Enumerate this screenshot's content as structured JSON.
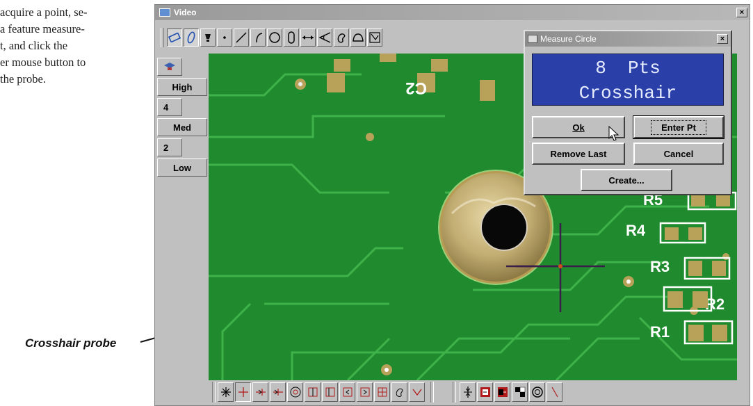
{
  "document": {
    "lines": [
      "acquire a point, se-",
      "a feature measure-",
      "t,  and  click  the",
      "er mouse button to",
      "the probe."
    ],
    "caption": "Crosshair probe"
  },
  "video_window": {
    "title": "Video",
    "close_label": "×",
    "toolbar_icons": [
      "rectangle-tool-icon",
      "ellipse-tool-icon",
      "light-icon",
      "point-icon",
      "line-icon",
      "arc-icon",
      "circle-icon",
      "slot-icon",
      "distance-icon",
      "angle-icon",
      "blob-icon",
      "curve-icon",
      "profile-icon",
      "view-icon"
    ],
    "side_buttons": {
      "top_icon": "cap-icon",
      "high": "High",
      "four": "4",
      "med": "Med",
      "two": "2",
      "low": "Low"
    },
    "bottom_icons": [
      "burst-probe-icon",
      "crosshair-probe-icon",
      "edge-probe-icon",
      "edge-both-probe-icon",
      "target-probe-icon",
      "edge-box-icon",
      "edge-box-alt-icon",
      "box-left-icon",
      "box-right-icon",
      "box-center-icon",
      "blob-probe-icon",
      "chevron-probe-icon",
      "focus-icon",
      "light-left-icon",
      "light-right-icon",
      "checker-icon",
      "ring-icon",
      "slash-icon"
    ]
  },
  "pcb_labels": {
    "c2": "C2",
    "r5": "R5",
    "r4": "R4",
    "r3": "R3",
    "r2": "R2",
    "r1": "R1"
  },
  "measure_dialog": {
    "title": "Measure Circle",
    "close_label": "×",
    "display_line1": "8  Pts",
    "display_line2": "Crosshair",
    "ok": "Ok",
    "enter_pt": "Enter Pt",
    "remove_last": "Remove Last",
    "cancel": "Cancel",
    "create": "Create..."
  },
  "colors": {
    "pcb_green": "#1f8a2e",
    "trace_green": "#3fb34a",
    "lcd_blue": "#2a40a8",
    "pad_copper": "#b8a25a",
    "crosshair": "#3b1f4a"
  }
}
